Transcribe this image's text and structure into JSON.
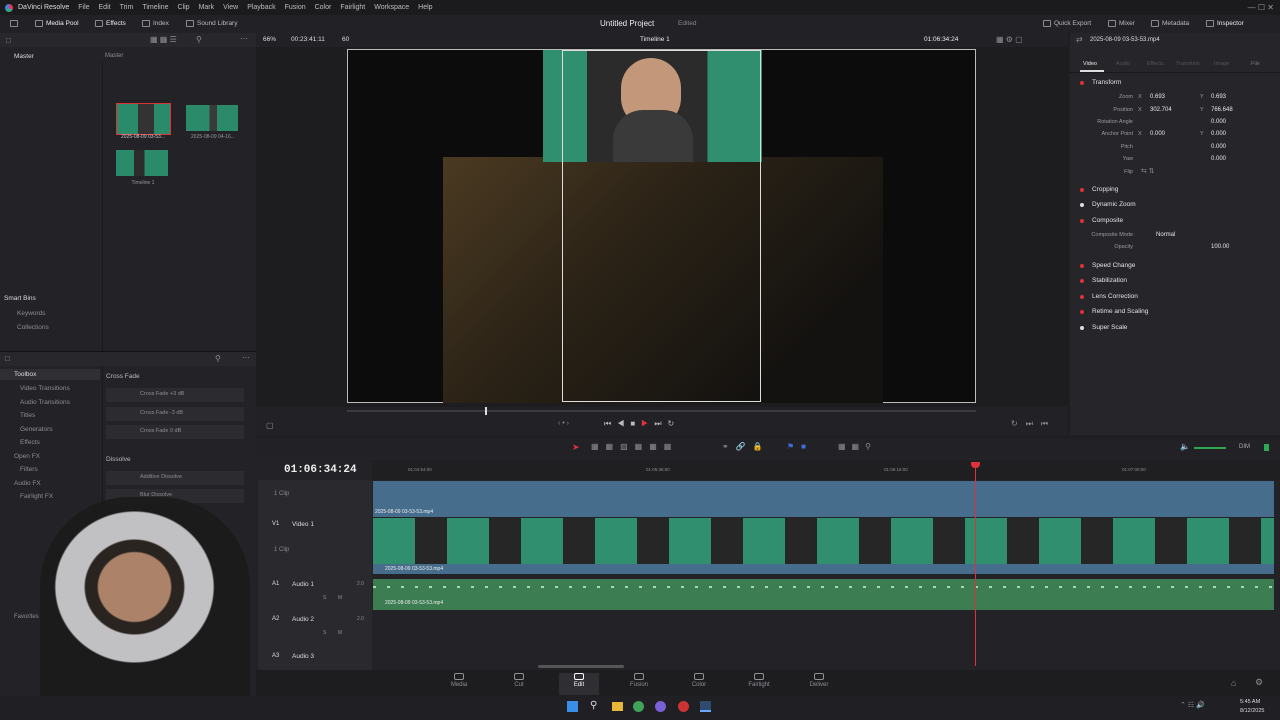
{
  "app": {
    "name": "DaVinci Resolve",
    "menu": [
      "File",
      "Edit",
      "Trim",
      "Timeline",
      "Clip",
      "Mark",
      "View",
      "Playback",
      "Fusion",
      "Color",
      "Fairlight",
      "Workspace",
      "Help"
    ]
  },
  "toolbar": {
    "media_pool": "Media Pool",
    "effects": "Effects",
    "index": "Index",
    "sound_library": "Sound Library",
    "project_title": "Untitled Project",
    "project_status": "Edited",
    "quick_export": "Quick Export",
    "mixer": "Mixer",
    "metadata": "Metadata",
    "inspector": "Inspector"
  },
  "media_pool": {
    "root": "Master",
    "bin_label": "Master",
    "clips": [
      {
        "name": "2025-08-09 03-53..."
      },
      {
        "name": "2025-08-09 04-16..."
      },
      {
        "name": "Timeline 1"
      }
    ],
    "smart_bins": "Smart Bins",
    "smart_bin_items": [
      "Keywords",
      "Collections"
    ]
  },
  "viewer": {
    "zoom": "66%",
    "source_tc": "00:23:41:11",
    "fps": "60",
    "timeline_name": "Timeline 1",
    "record_tc": "01:06:34:24",
    "clip_name": "2025-08-09 03-53-53.mp4"
  },
  "effects_library": {
    "toolbox": "Toolbox",
    "toolbox_items": [
      "Video Transitions",
      "Audio Transitions",
      "Titles",
      "Generators",
      "Effects"
    ],
    "open_fx": "Open FX",
    "open_fx_items": [
      "Filters"
    ],
    "audio_fx": "Audio FX",
    "audio_fx_items": [
      "Fairlight FX"
    ],
    "favorites": "Favorites",
    "cross_fade_header": "Cross Fade",
    "cross_fade_items": [
      "Cross Fade +3 dB",
      "Cross Fade -3 dB",
      "Cross Fade 0 dB"
    ],
    "dissolve_header": "Dissolve",
    "dissolve_items": [
      "Additive Dissolve",
      "Blur Dissolve"
    ]
  },
  "inspector": {
    "tabs": [
      "Video",
      "Audio",
      "Effects",
      "Transition",
      "Image",
      "File"
    ],
    "transform": "Transform",
    "zoom_label": "Zoom",
    "zoom_x": "0.693",
    "zoom_y": "0.693",
    "position_label": "Position",
    "position_x": "302.704",
    "position_y": "766.648",
    "rotation_label": "Rotation Angle",
    "rotation": "0.000",
    "anchor_label": "Anchor Point",
    "anchor_x": "0.000",
    "anchor_y": "0.000",
    "pitch_label": "Pitch",
    "pitch": "0.000",
    "yaw_label": "Yaw",
    "yaw": "0.000",
    "flip_label": "Flip",
    "x": "X",
    "y": "Y",
    "sections": [
      "Cropping",
      "Dynamic Zoom",
      "Composite",
      "Speed Change",
      "Stabilization",
      "Lens Correction",
      "Retime and Scaling",
      "Super Scale"
    ],
    "composite_mode_label": "Composite Mode",
    "composite_mode": "Normal",
    "opacity_label": "Opacity",
    "opacity": "100.00"
  },
  "timeline": {
    "timecode": "01:06:34:24",
    "ruler": [
      "01:04:54:00",
      "01:05:36:00",
      "01:06:18:00",
      "01:07:00:00"
    ],
    "tracks": [
      {
        "id": "",
        "name": "",
        "clips": "1 Clip"
      },
      {
        "id": "V1",
        "name": "Video 1",
        "clips": "1 Clip"
      },
      {
        "id": "A1",
        "name": "Audio 1",
        "level": "2.0"
      },
      {
        "id": "A2",
        "name": "Audio 2",
        "level": "2.0"
      },
      {
        "id": "A3",
        "name": "Audio 3",
        "level": "2.0"
      }
    ],
    "v2_clip": "2025-08-09 03-53-53.mp4",
    "v1_clip": "2025-08-09 03-53-53.mp4",
    "a1_clip": "2025-08-09 03-53-53.mp4",
    "dim": "DIM",
    "solo": "S",
    "mute": "M"
  },
  "pages": [
    "Media",
    "Cut",
    "Edit",
    "Fusion",
    "Color",
    "Fairlight",
    "Deliver"
  ],
  "active_page": "Edit",
  "taskbar": {
    "time": "5:45 AM",
    "date": "8/12/2025"
  },
  "colors": {
    "accent": "#e0303a",
    "video_clip": "#3f6f90",
    "audio_clip": "#3f8a55",
    "panel": "#26262a"
  }
}
